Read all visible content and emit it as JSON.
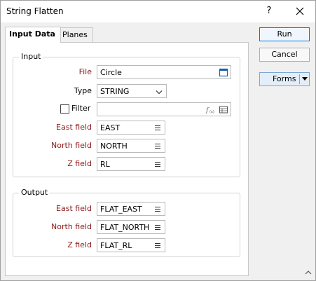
{
  "window": {
    "title": "String Flatten",
    "help_label": "?"
  },
  "tabs": [
    {
      "label": "Input Data",
      "active": true
    },
    {
      "label": "Planes",
      "active": false
    }
  ],
  "input_group": {
    "legend": "Input",
    "file": {
      "label": "File",
      "value": "Circle",
      "button_icon": "browse-icon"
    },
    "type": {
      "label": "Type",
      "value": "STRING",
      "button_icon": "chevron-down-icon"
    },
    "filter": {
      "label": "Filter",
      "checked": false,
      "value": "",
      "icons": [
        "expression-icon",
        "table-icon"
      ]
    },
    "east_field": {
      "label": "East field",
      "value": "EAST"
    },
    "north_field": {
      "label": "North field",
      "value": "NORTH"
    },
    "z_field": {
      "label": "Z field",
      "value": "RL"
    }
  },
  "output_group": {
    "legend": "Output",
    "east_field": {
      "label": "East field",
      "value": "FLAT_EAST"
    },
    "north_field": {
      "label": "North field",
      "value": "FLAT_NORTH"
    },
    "z_field": {
      "label": "Z field",
      "value": "FLAT_RL"
    }
  },
  "buttons": {
    "run": "Run",
    "cancel": "Cancel",
    "forms": "Forms"
  },
  "colors": {
    "required_label": "#8b1a1a",
    "primary_border": "#0078d7"
  }
}
